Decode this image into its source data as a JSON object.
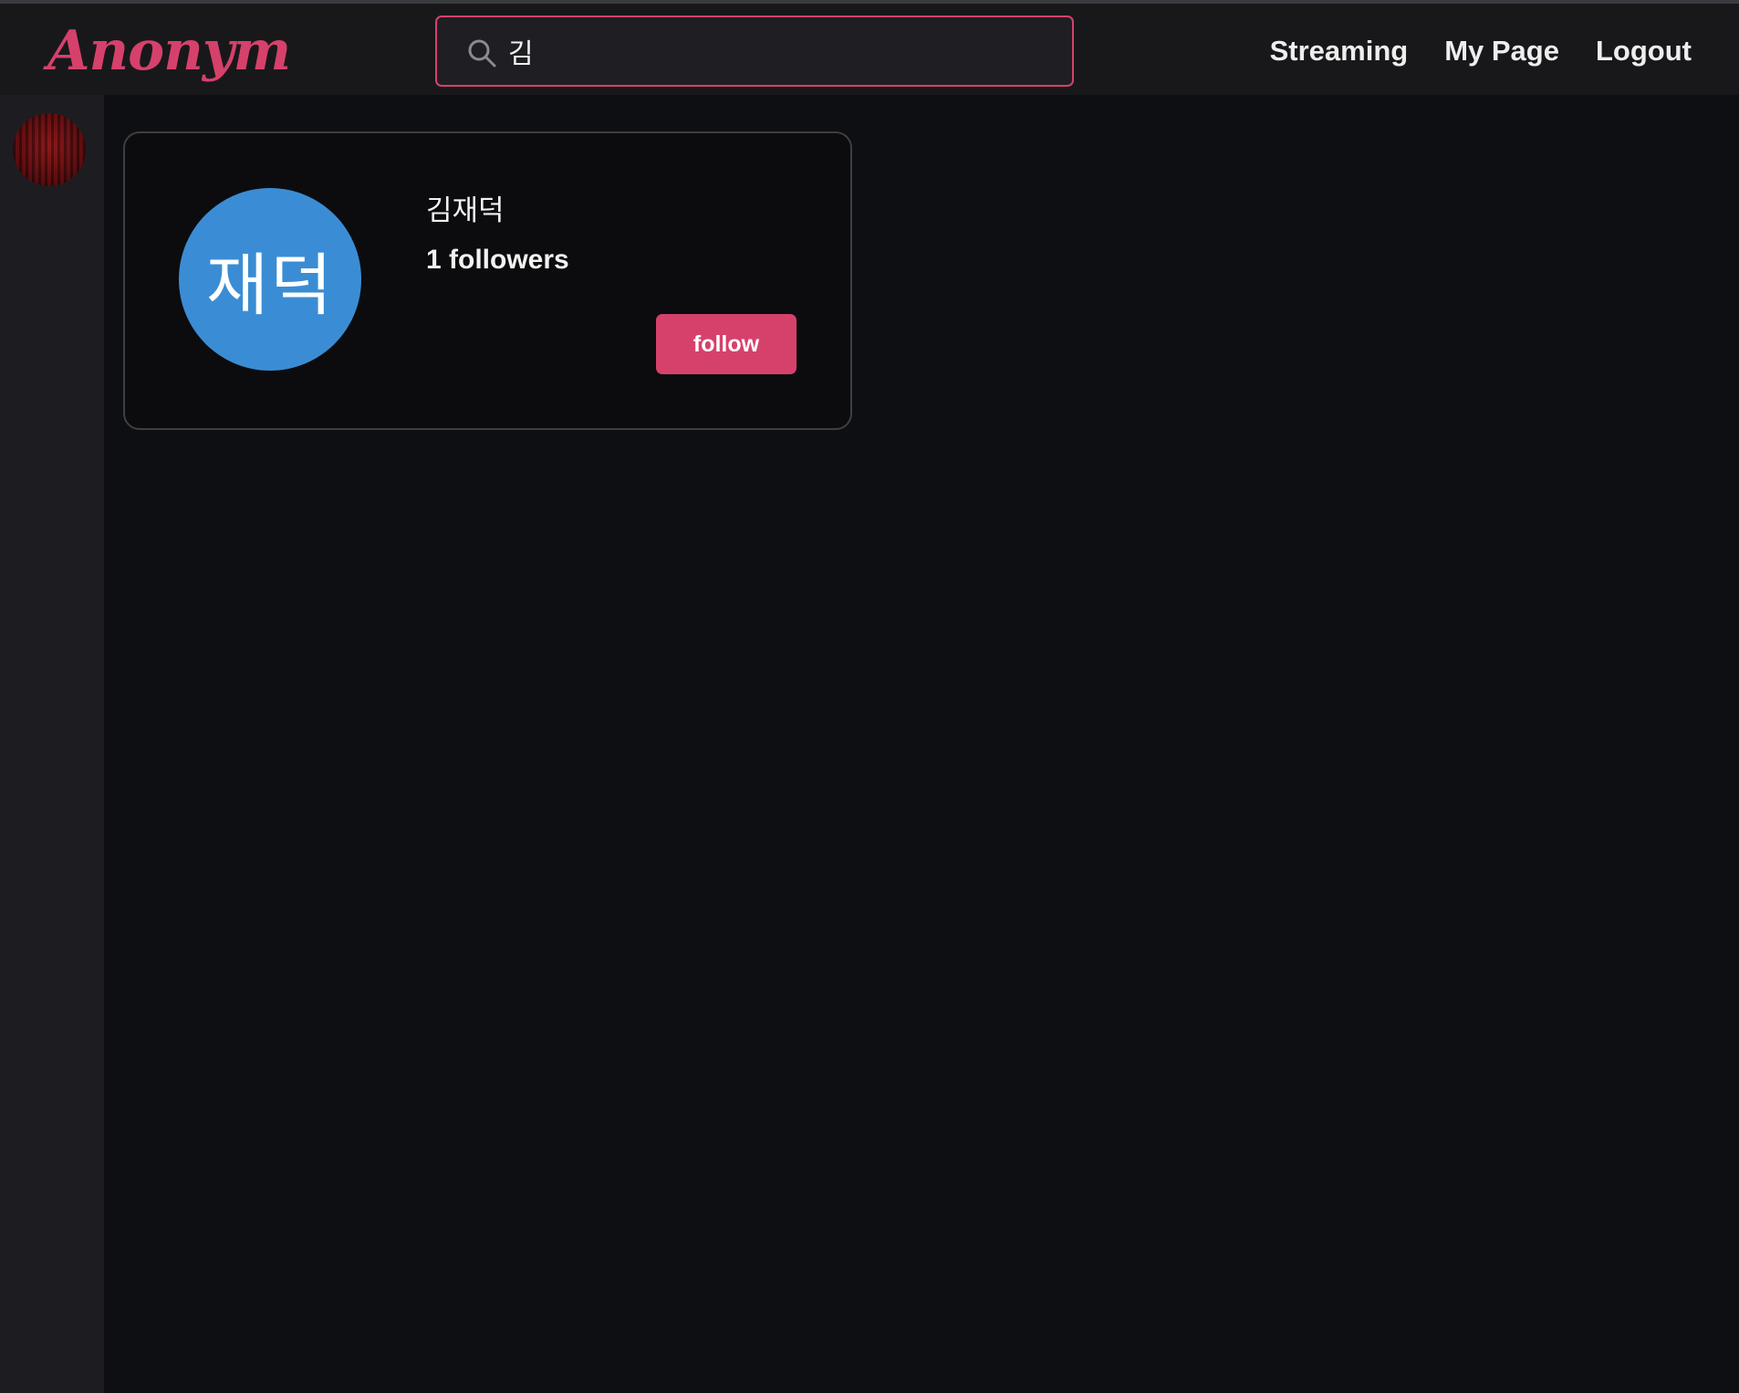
{
  "app": {
    "logo": "Anonym"
  },
  "search": {
    "value": "김",
    "icon": "search-icon"
  },
  "nav": {
    "items": [
      {
        "label": "Streaming"
      },
      {
        "label": "My Page"
      },
      {
        "label": "Logout"
      }
    ]
  },
  "sidebar": {
    "avatar_icon": "user-avatar"
  },
  "result": {
    "name": "김재덕",
    "avatar_text": "재덕",
    "followers": "1 followers",
    "follow_label": "follow"
  },
  "colors": {
    "accent": "#d6416b",
    "avatar_bg": "#3a8dd4",
    "header_bg": "#18181b",
    "page_bg": "#0e0f12",
    "sidebar_bg": "#1d1d21"
  }
}
